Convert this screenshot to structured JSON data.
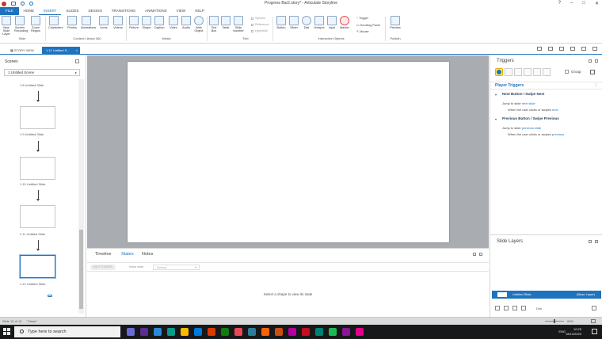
{
  "window": {
    "title": "Progress Bar2.story* - Articulate Storyline",
    "controls": [
      "?",
      "–",
      "□",
      "✕"
    ]
  },
  "ribbon_tabs": [
    "FILE",
    "HOME",
    "INSERT",
    "SLIDES",
    "DESIGN",
    "TRANSITIONS",
    "ANIMATIONS",
    "VIEW",
    "HELP"
  ],
  "ribbon_active_tab": "INSERT",
  "ribbon": {
    "slide_group": {
      "label": "Slide",
      "buttons": [
        "New Slide Layer",
        "Screen Recording",
        "Zoom Region"
      ]
    },
    "content_library": {
      "label": "Content Library 360",
      "buttons": [
        "Characters",
        "Photos",
        "Illustrations",
        "Icons",
        "Videos"
      ]
    },
    "media": {
      "label": "Media",
      "buttons": [
        "Picture",
        "Shape",
        "Caption",
        "Video",
        "Audio",
        "Web Object"
      ]
    },
    "text": {
      "label": "Text",
      "buttons": [
        "Text Box",
        "Table",
        "Slide Number"
      ],
      "checks": [
        "Symbol",
        "Reference",
        "Hyperlink"
      ]
    },
    "interactive": {
      "label": "Interactive Objects",
      "buttons": [
        "Button",
        "Slider",
        "Dial",
        "Hotspot",
        "Input",
        "Marker"
      ],
      "trigger_items": [
        "Trigger",
        "Scrolling Panel",
        "Mouse"
      ]
    },
    "publish": {
      "label": "Publish",
      "buttons": [
        "Preview"
      ]
    }
  },
  "view_tabs": {
    "story_view": "STORY VIEW",
    "slide_tab": "1.12 Untitled S...",
    "close": "×"
  },
  "scenes": {
    "header": "Scenes",
    "selected_scene": "1 Untitled Scene",
    "slides": [
      "1.8 Untitled Slide",
      "1.9 Untitled Slide",
      "1.10 Untitled Slide",
      "1.11 Untitled Slide",
      "1.12 Untitled Slide"
    ]
  },
  "bottom_panel": {
    "tabs": [
      "Timeline",
      "States",
      "Notes"
    ],
    "active_tab": "States",
    "edit_states": "EDIT STATES",
    "initial_state_label": "Initial state:",
    "initial_state_value": "Normal",
    "message": "Select a shape to view its state"
  },
  "triggers": {
    "header": "Triggers",
    "group_label": "Group",
    "section": "Player Triggers",
    "items": [
      {
        "title": "Next Button / Swipe Next",
        "action": "Jump to slide",
        "action_target": "next slide",
        "condition": "When the user clicks or swipes",
        "condition_target": "next"
      },
      {
        "title": "Previous Button / Swipe Previous",
        "action": "Jump to slide",
        "action_target": "previous slide",
        "condition": "When the user clicks or swipes",
        "condition_target": "previous"
      }
    ]
  },
  "layers": {
    "header": "Slide Layers",
    "base_name": "Untitled Slide",
    "base_tag": "(Base Layer)",
    "dim_label": "Dim"
  },
  "status": {
    "slide_info": "Slide 12 of 12",
    "state": "\"Clean\"",
    "zoom": "69%"
  },
  "taskbar": {
    "search_placeholder": "Type here to search",
    "language": "ENG",
    "time": "10:25",
    "date": "18/10/2020",
    "app_colors": [
      "#6b6bd6",
      "#5c2d91",
      "#2b88d8",
      "#0a9b8c",
      "#ffb900",
      "#0078d7",
      "#d83b01",
      "#107c10",
      "#e74856",
      "#2d7d9a",
      "#f7630c",
      "#ca5010",
      "#b4009e",
      "#c50f1f",
      "#008272",
      "#1db954",
      "#881798",
      "#e3008c"
    ]
  }
}
